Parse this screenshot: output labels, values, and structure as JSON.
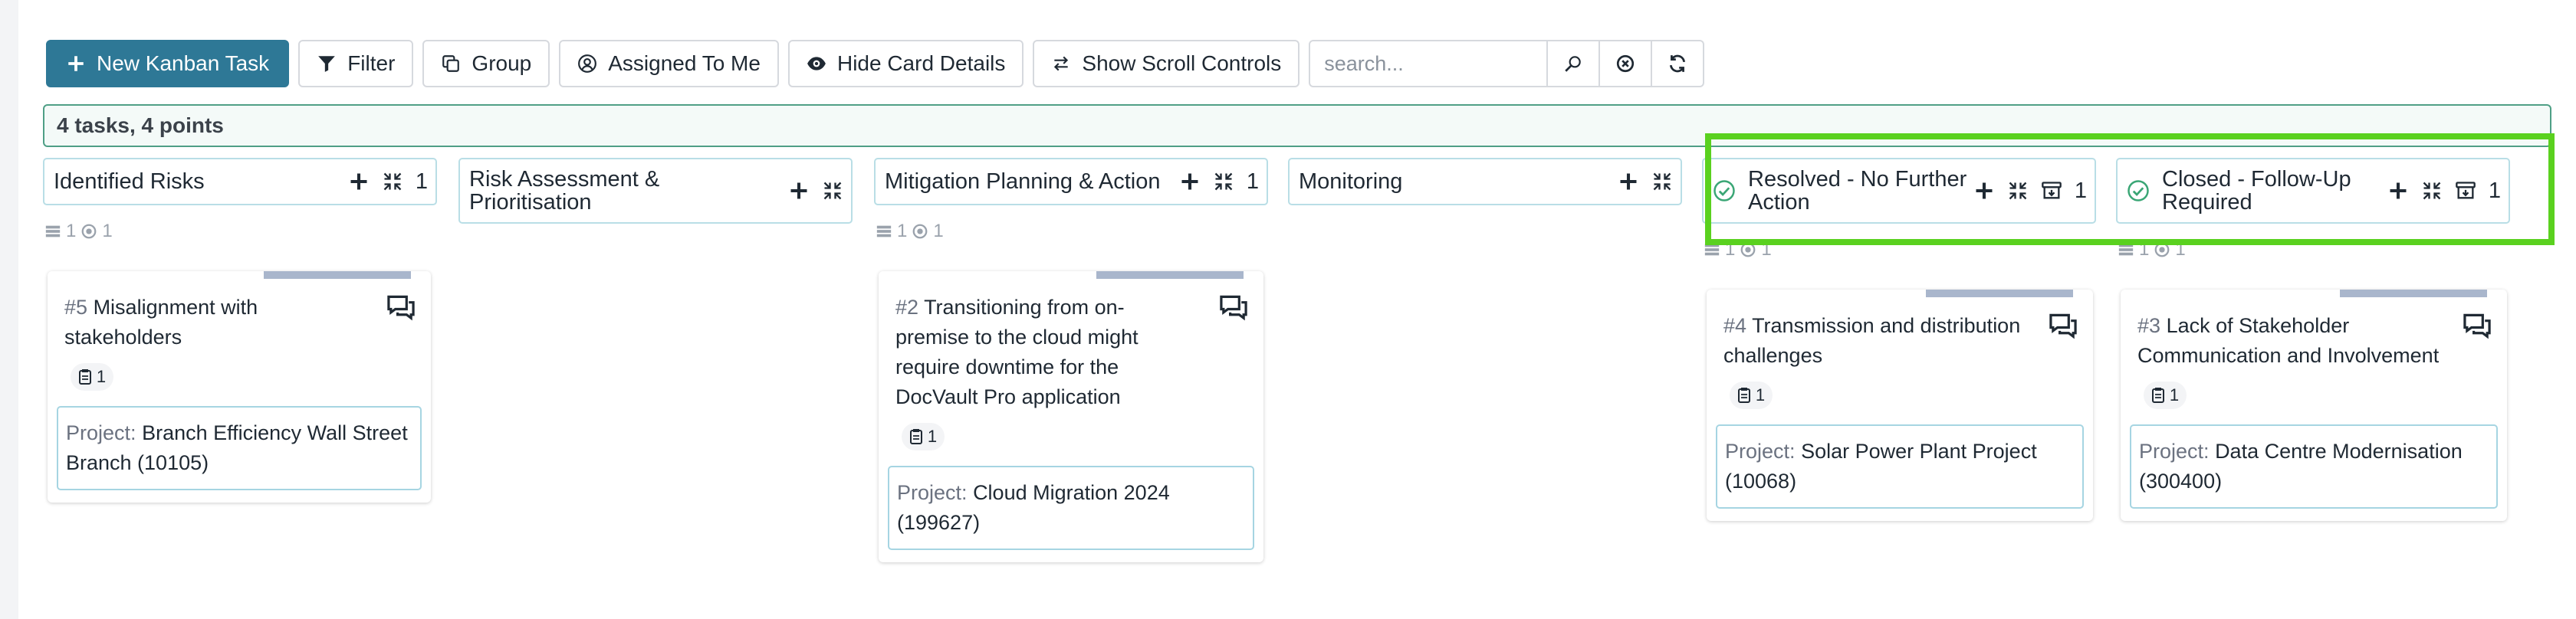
{
  "toolbar": {
    "new_task": "New Kanban Task",
    "filter": "Filter",
    "group": "Group",
    "assigned": "Assigned To Me",
    "hide_details": "Hide Card Details",
    "scroll_controls": "Show Scroll Controls",
    "search_placeholder": "search...",
    "search_value": ""
  },
  "summary": "4 tasks, 4 points",
  "colors": {
    "primary": "#2e7896",
    "summary_border": "#4f9f86",
    "highlight": "#5ad11f",
    "column_border": "#b9dee6"
  },
  "columns": [
    {
      "title": "Identified Risks",
      "count": "1",
      "meta_rows": "1",
      "meta_points": "1"
    },
    {
      "title": "Risk Assessment & Prioritisation",
      "count": ""
    },
    {
      "title": "Mitigation Planning & Action",
      "count": "1",
      "meta_rows": "1",
      "meta_points": "1"
    },
    {
      "title": "Monitoring",
      "count": ""
    },
    {
      "title": "Resolved - No Further Action",
      "count": "1",
      "meta_rows": "1",
      "meta_points": "1"
    },
    {
      "title": "Closed - Follow-Up Required",
      "count": "1",
      "meta_rows": "1",
      "meta_points": "1"
    }
  ],
  "cards": [
    {
      "num": "#5",
      "title": "Misalignment with stakeholders",
      "badge": "1",
      "project_label": "Project:",
      "project": "Branch Efficiency Wall Street Branch (10105)"
    },
    {
      "num": "#2",
      "title": "Transitioning from on-premise to the cloud might require downtime for the DocVault Pro application",
      "badge": "1",
      "project_label": "Project:",
      "project": "Cloud Migration 2024 (199627)"
    },
    {
      "num": "#4",
      "title": "Transmission and distribution challenges",
      "badge": "1",
      "project_label": "Project:",
      "project": "Solar Power Plant Project (10068)"
    },
    {
      "num": "#3",
      "title": "Lack of Stakeholder Communication and Involvement",
      "badge": "1",
      "project_label": "Project:",
      "project": "Data Centre Modernisation (300400)"
    }
  ],
  "icons": [
    "plus-icon",
    "filter-icon",
    "group-icon",
    "user-circle-icon",
    "eye-icon",
    "swap-icon",
    "search-icon",
    "clear-icon",
    "refresh-icon",
    "collapse-icon",
    "archive-icon",
    "check-circle-icon",
    "chat-icon",
    "clipboard-icon"
  ]
}
